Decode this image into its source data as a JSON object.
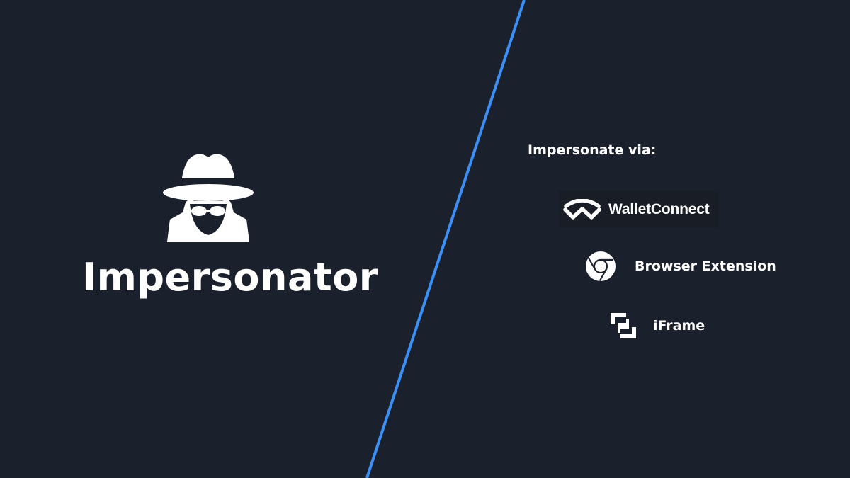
{
  "brand": {
    "name": "Impersonator",
    "icon": "spy-icon"
  },
  "methods": {
    "heading": "Impersonate via:",
    "items": [
      {
        "id": "walletconnect",
        "label": "WalletConnect",
        "icon": "walletconnect-icon"
      },
      {
        "id": "browser-extension",
        "label": "Browser Extension",
        "icon": "chrome-icon"
      },
      {
        "id": "iframe",
        "label": "iFrame",
        "icon": "iframe-icon"
      }
    ]
  },
  "colors": {
    "background": "#1b202d",
    "divider": "#3c8ff5",
    "text": "#ffffff",
    "badge_background": "#181d26"
  }
}
